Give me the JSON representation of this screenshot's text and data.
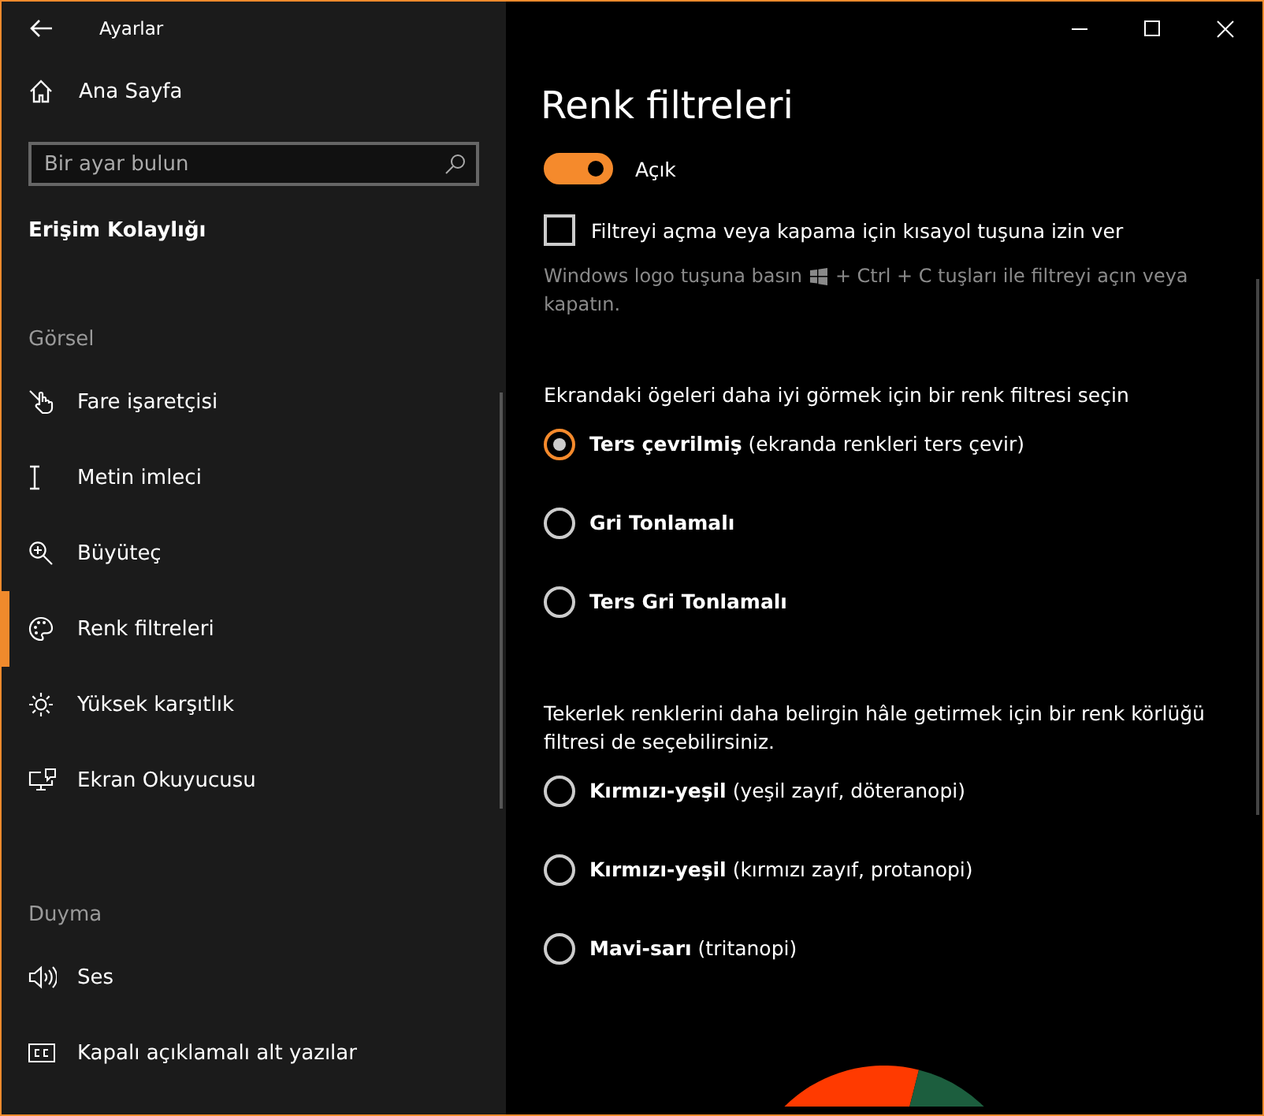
{
  "window": {
    "title": "Ayarlar"
  },
  "sidebar": {
    "home": "Ana Sayfa",
    "search": {
      "placeholder": "Bir ayar bulun"
    },
    "category": "Erişim Kolaylığı",
    "groups": [
      {
        "heading": "Görsel",
        "items": [
          {
            "label": "Fare işaretçisi",
            "kind": "pointer",
            "selected": false
          },
          {
            "label": "Metin imleci",
            "kind": "cursor",
            "selected": false
          },
          {
            "label": "Büyüteç",
            "kind": "magnifier",
            "selected": false
          },
          {
            "label": "Renk filtreleri",
            "kind": "palette",
            "selected": true
          },
          {
            "label": "Yüksek karşıtlık",
            "kind": "contrast",
            "selected": false
          },
          {
            "label": "Ekran Okuyucusu",
            "kind": "narrator",
            "selected": false
          }
        ]
      },
      {
        "heading": "Duyma",
        "items": [
          {
            "label": "Ses",
            "kind": "audio",
            "selected": false
          },
          {
            "label": "Kapalı açıklamalı alt yazılar",
            "kind": "captions",
            "selected": false
          }
        ]
      }
    ]
  },
  "content": {
    "title": "Renk filtreleri",
    "toggle": {
      "on": true,
      "state_label": "Açık"
    },
    "shortcut_checkbox": {
      "label": "Filtreyi açma veya kapama için kısayol tuşuna izin ver",
      "checked": false
    },
    "hint_parts": [
      "Windows logo tuşuna basın",
      "+ Ctrl + C tuşları ile filtreyi açın veya",
      "kapatın."
    ],
    "filter_prompt": "Ekrandaki ögeleri daha iyi görmek için bir renk filtresi seçin",
    "filters": [
      {
        "label": "**Ters çevrilmiş** (ekranda renkleri ters çevir)",
        "selected": true
      },
      {
        "label": "**Gri Tonlamalı**",
        "selected": false
      },
      {
        "label": "**Ters Gri Tonlamalı**",
        "selected": false
      }
    ],
    "colorblind_prompt": "Tekerlek renklerini daha belirgin hâle getirmek için bir renk körlüğü filtresi de seçebilirsiniz.",
    "colorblind_filters": [
      {
        "label": "**Kırmızı-yeşil** (yeşil zayıf, döteranopi)",
        "selected": false
      },
      {
        "label": "**Kırmızı-yeşil** (kırmızı zayıf, protanopi)",
        "selected": false
      },
      {
        "label": "**Mavi-sarı** (tritanopi)",
        "selected": false
      }
    ]
  }
}
